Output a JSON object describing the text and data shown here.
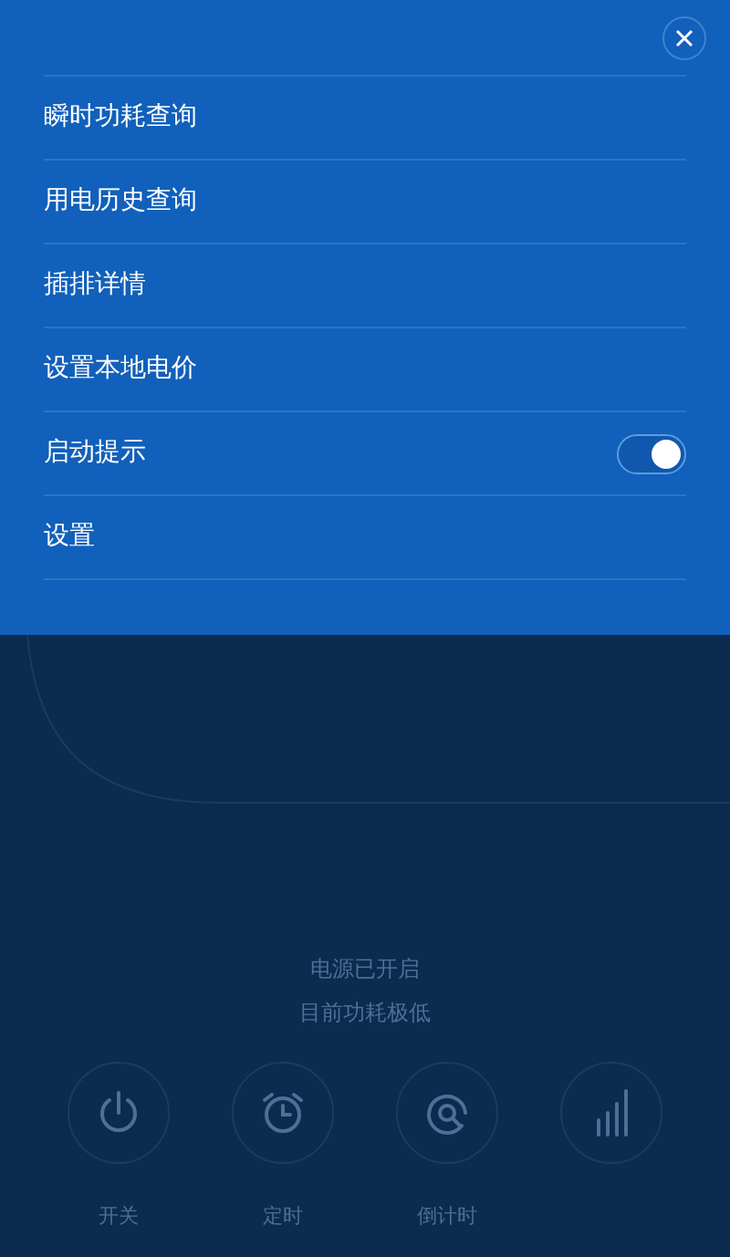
{
  "menu": {
    "items": [
      {
        "kind": "link",
        "label": "瞬时功耗查询"
      },
      {
        "kind": "link",
        "label": "用电历史查询"
      },
      {
        "kind": "link",
        "label": "插排详情"
      },
      {
        "kind": "link",
        "label": "设置本地电价"
      },
      {
        "kind": "toggle",
        "label": "启动提示",
        "on": true
      },
      {
        "kind": "link",
        "label": "设置"
      }
    ]
  },
  "status": [
    "电源已开启",
    "目前功耗极低"
  ],
  "controls": [
    {
      "kind": "power",
      "label": "开关"
    },
    {
      "kind": "timer",
      "label": "定时"
    },
    {
      "kind": "countdown",
      "label": "倒计时"
    },
    {
      "kind": "stats"
    }
  ]
}
